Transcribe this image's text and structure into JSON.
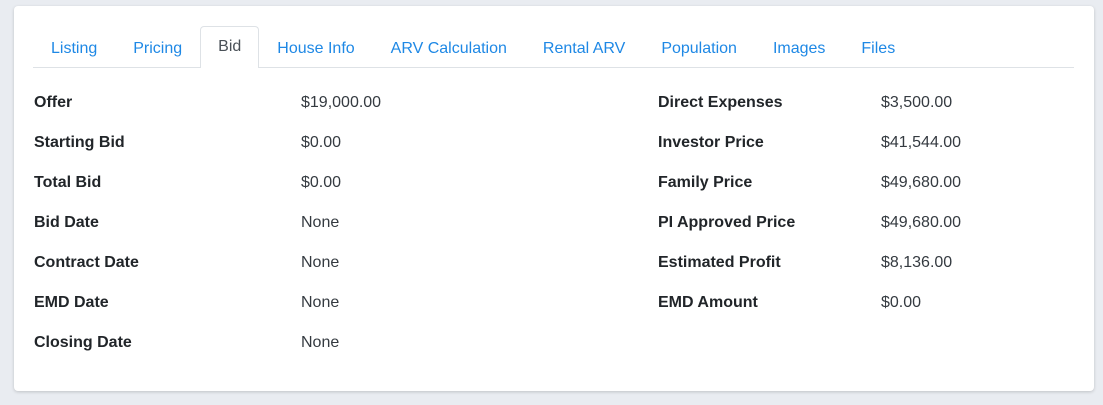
{
  "tabs": [
    {
      "label": "Listing",
      "active": false
    },
    {
      "label": "Pricing",
      "active": false
    },
    {
      "label": "Bid",
      "active": true
    },
    {
      "label": "House Info",
      "active": false
    },
    {
      "label": "ARV Calculation",
      "active": false
    },
    {
      "label": "Rental ARV",
      "active": false
    },
    {
      "label": "Population",
      "active": false
    },
    {
      "label": "Images",
      "active": false
    },
    {
      "label": "Files",
      "active": false
    }
  ],
  "bid_left": [
    {
      "label": "Offer",
      "value": "$19,000.00"
    },
    {
      "label": "Starting Bid",
      "value": "$0.00"
    },
    {
      "label": "Total Bid",
      "value": "$0.00"
    },
    {
      "label": "Bid Date",
      "value": "None"
    },
    {
      "label": "Contract Date",
      "value": "None"
    },
    {
      "label": "EMD Date",
      "value": "None"
    },
    {
      "label": "Closing Date",
      "value": "None"
    }
  ],
  "bid_right": [
    {
      "label": "Direct Expenses",
      "value": "$3,500.00"
    },
    {
      "label": "Investor Price",
      "value": "$41,544.00"
    },
    {
      "label": "Family Price",
      "value": "$49,680.00"
    },
    {
      "label": "PI Approved Price",
      "value": "$49,680.00"
    },
    {
      "label": "Estimated Profit",
      "value": "$8,136.00"
    },
    {
      "label": "EMD Amount",
      "value": "$0.00"
    }
  ],
  "colors": {
    "link": "#1e88e5",
    "active_tab_text": "#495057",
    "border": "#dee2e6",
    "label_text": "#212529",
    "background": "#e9ecf1"
  }
}
